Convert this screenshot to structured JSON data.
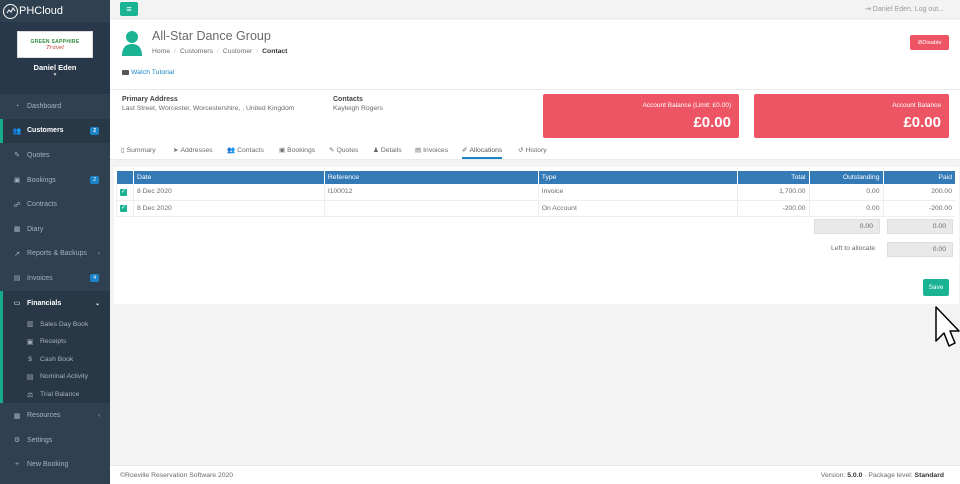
{
  "app": {
    "logo_text": "PHCloud"
  },
  "profile": {
    "brand_line1": "GREEN SAPPHIRE",
    "brand_line2": "Travel",
    "user_name": "Daniel Eden"
  },
  "sidebar": {
    "items": [
      {
        "label": "Dashboard",
        "icon": "dashboard-icon"
      },
      {
        "label": "Customers",
        "icon": "users-icon",
        "badge": "2"
      },
      {
        "label": "Quotes",
        "icon": "pencil-icon"
      },
      {
        "label": "Bookings",
        "icon": "ticket-icon",
        "badge": "2"
      },
      {
        "label": "Contracts",
        "icon": "handshake-icon"
      },
      {
        "label": "Diary",
        "icon": "calendar-icon"
      },
      {
        "label": "Reports & Backups",
        "icon": "chart-icon"
      },
      {
        "label": "Invoices",
        "icon": "file-icon",
        "badge": "4"
      },
      {
        "label": "Financials",
        "icon": "money-icon"
      }
    ],
    "sub_items": [
      {
        "label": "Sales Day Book",
        "icon": "book-icon"
      },
      {
        "label": "Receipts",
        "icon": "receipt-icon"
      },
      {
        "label": "Cash Book",
        "icon": "dollar-icon"
      },
      {
        "label": "Nominal Activity",
        "icon": "list-icon"
      },
      {
        "label": "Trial Balance",
        "icon": "scale-icon"
      }
    ],
    "bottom_items": [
      {
        "label": "Resources",
        "icon": "resources-icon"
      },
      {
        "label": "Settings",
        "icon": "gears-icon"
      },
      {
        "label": "New Booking",
        "icon": "plus-icon"
      }
    ]
  },
  "topbar": {
    "logout_text": "Daniel Eden, Log out..."
  },
  "header": {
    "title": "All-Star Dance Group",
    "breadcrumbs": [
      "Home",
      "Customers",
      "Customer",
      "Contact"
    ],
    "tutorial_label": "Watch Tutorial",
    "disable_label": "Disable"
  },
  "info": {
    "address_label": "Primary Address",
    "address_value": "Last Street, Worcester, Worcestershire, , United Kingdom",
    "contacts_label": "Contacts",
    "contacts_value": "Kayleigh Rogers",
    "balance1_label": "Account Balance (Limit: £0.00)",
    "balance1_value": "£0.00",
    "balance2_label": "Account Balance",
    "balance2_value": "£0.00"
  },
  "tabs": [
    {
      "label": "Summary",
      "icon": "doc-icon"
    },
    {
      "label": "Addresses",
      "icon": "send-icon"
    },
    {
      "label": "Contacts",
      "icon": "users-icon"
    },
    {
      "label": "Bookings",
      "icon": "ticket-icon"
    },
    {
      "label": "Quotes",
      "icon": "pencil-icon"
    },
    {
      "label": "Details",
      "icon": "user-icon"
    },
    {
      "label": "Invoices",
      "icon": "file-icon"
    },
    {
      "label": "Allocations",
      "icon": "pen-icon"
    },
    {
      "label": "History",
      "icon": "history-icon"
    }
  ],
  "table": {
    "columns": [
      "Date",
      "Reference",
      "Type",
      "Total",
      "Outstanding",
      "Paid"
    ],
    "rows": [
      {
        "date": "8 Dec 2020",
        "reference": "I100012",
        "type": "Invoice",
        "total": "1,700.00",
        "outstanding": "0.00",
        "paid": "200.00"
      },
      {
        "date": "8 Dec 2020",
        "reference": "",
        "type": "On Account",
        "total": "-200.00",
        "outstanding": "0.00",
        "paid": "-200.00"
      }
    ],
    "sum_outstanding": "0.00",
    "sum_paid": "0.00",
    "left_label": "Left to allocate",
    "left_value": "0.00",
    "save_label": "Save"
  },
  "footer": {
    "copyright": "©Roeville Reservation Software 2020",
    "version_label": "Version:",
    "version": "5.0.0",
    "package_label": "Package level:",
    "package": "Standard"
  },
  "colors": {
    "accent": "#1ab394",
    "danger": "#ed5565",
    "sidebar": "#2f4050",
    "table_header": "#337ab7"
  }
}
